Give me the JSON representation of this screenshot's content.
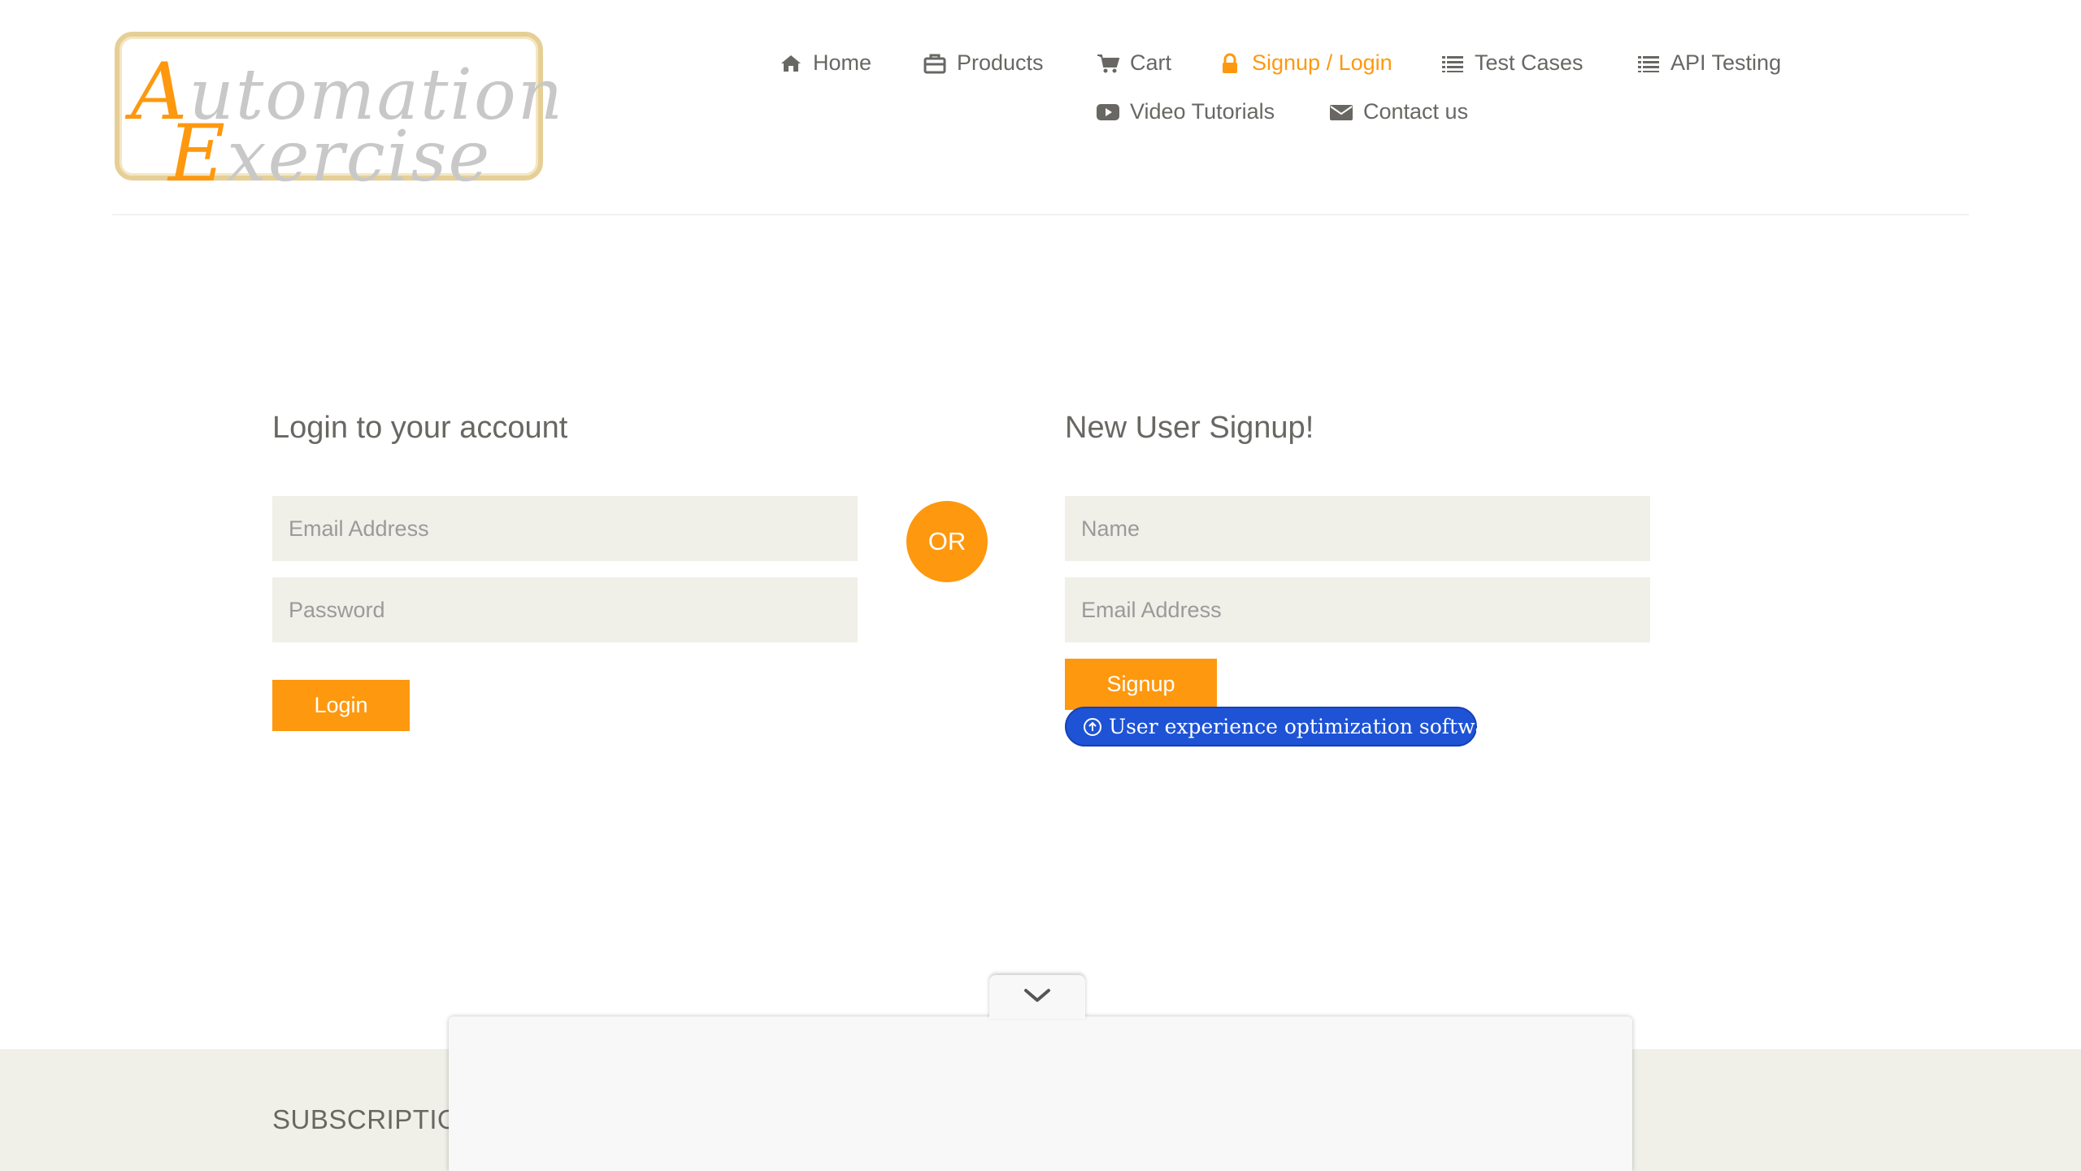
{
  "brand": {
    "logo_line1_cap": "A",
    "logo_line1_rest": "utomation",
    "logo_line2_cap": "E",
    "logo_line2_rest": "xercise",
    "accent_color": "#fe980f"
  },
  "nav": {
    "items": [
      {
        "label": "Home",
        "icon": "home-icon"
      },
      {
        "label": "Products",
        "icon": "briefcase-icon"
      },
      {
        "label": "Cart",
        "icon": "cart-icon"
      },
      {
        "label": "Signup / Login",
        "icon": "lock-icon",
        "active": true
      },
      {
        "label": "Test Cases",
        "icon": "list-icon"
      },
      {
        "label": "API Testing",
        "icon": "list-icon"
      },
      {
        "label": "Video Tutorials",
        "icon": "youtube-play-icon"
      },
      {
        "label": "Contact us",
        "icon": "envelope-icon"
      }
    ]
  },
  "login": {
    "title": "Login to your account",
    "email_placeholder": "Email Address",
    "password_placeholder": "Password",
    "button_label": "Login"
  },
  "divider": {
    "or_label": "OR"
  },
  "signup": {
    "title": "New User Signup!",
    "name_placeholder": "Name",
    "email_placeholder": "Email Address",
    "button_label": "Signup"
  },
  "extension_pill": {
    "label": "User experience optimization software",
    "icon": "circle-up-arrow-icon",
    "color": "#1e53d6"
  },
  "footer": {
    "subscription_title": "SUBSCRIPTIO"
  },
  "ad_overlay": {
    "collapse_icon": "chevron-down-icon"
  }
}
